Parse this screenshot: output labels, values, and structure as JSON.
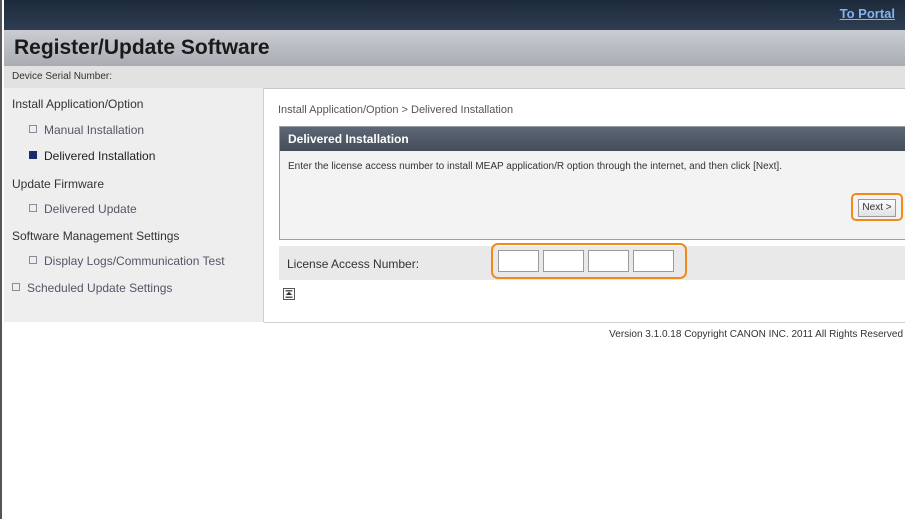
{
  "header": {
    "portal_link": "To Portal",
    "title": "Register/Update Software",
    "serial_label": "Device Serial Number:"
  },
  "sidebar": {
    "groups": [
      {
        "label": "Install Application/Option",
        "items": [
          {
            "label": "Manual Installation",
            "selected": false
          },
          {
            "label": "Delivered Installation",
            "selected": true
          }
        ]
      },
      {
        "label": "Update Firmware",
        "items": [
          {
            "label": "Delivered Update",
            "selected": false
          }
        ]
      },
      {
        "label": "Software Management Settings",
        "items": [
          {
            "label": "Display Logs/Communication Test",
            "selected": false
          }
        ]
      }
    ],
    "scheduled_item": {
      "label": "Scheduled Update Settings",
      "selected": false
    }
  },
  "main": {
    "breadcrumb": "Install Application/Option > Delivered Installation",
    "panel": {
      "title": "Delivered Installation",
      "description": "Enter the license access number to install MEAP application/R option through the internet, and then click [Next].",
      "next_button": "Next >"
    },
    "license": {
      "label": "License Access Number:",
      "fields": [
        "",
        "",
        "",
        ""
      ]
    },
    "top_icon": "back-to-top-icon"
  },
  "footer": {
    "copyright": "Version 3.1.0.18 Copyright CANON INC. 2011 All Rights Reserved"
  },
  "colors": {
    "highlight": "#f28a1b",
    "top_bar": "#1d2a3b",
    "panel_header": "#4f5866",
    "link": "#7fb4f0"
  }
}
